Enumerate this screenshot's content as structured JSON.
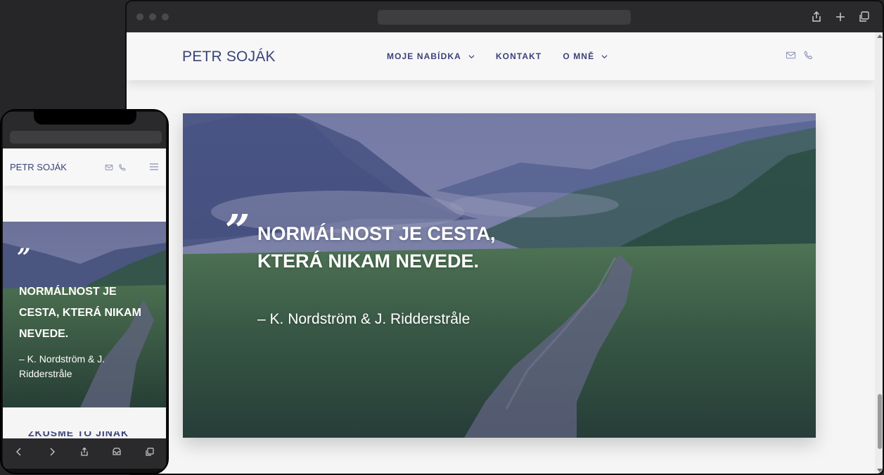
{
  "site": {
    "logo": "PETR SOJÁK",
    "nav": [
      {
        "label": "MOJE NABÍDKA",
        "has_dropdown": true
      },
      {
        "label": "KONTAKT",
        "has_dropdown": false
      },
      {
        "label": "O MNĚ",
        "has_dropdown": true
      }
    ],
    "header_icons": [
      "mail-icon",
      "phone-icon"
    ]
  },
  "hero": {
    "quote_mark": "”",
    "quote": "NORMÁLNOST JE CESTA, KTERÁ NIKAM NEVEDE.",
    "author": "– K. Nordström & J. Ridderstråle"
  },
  "mobile": {
    "logo": "PETR SOJÁK",
    "quote_mark": "”",
    "quote": "NORMÁLNOST JE CESTA, KTERÁ NIKAM NEVEDE.",
    "author": "– K. Nordström & J. Ridderstråle",
    "next_section_peek": "ZKUSME TO JINAK",
    "toolbar_icons": [
      "back-icon",
      "forward-icon",
      "share-icon",
      "tabs-overview-icon",
      "tabs-icon"
    ]
  },
  "browser": {
    "toolbar_icons": [
      "share-icon",
      "new-tab-icon",
      "tabs-icon"
    ]
  },
  "colors": {
    "brand": "#3a4378",
    "page_bg": "#f5f5f6",
    "chrome": "#2a2a2c"
  }
}
